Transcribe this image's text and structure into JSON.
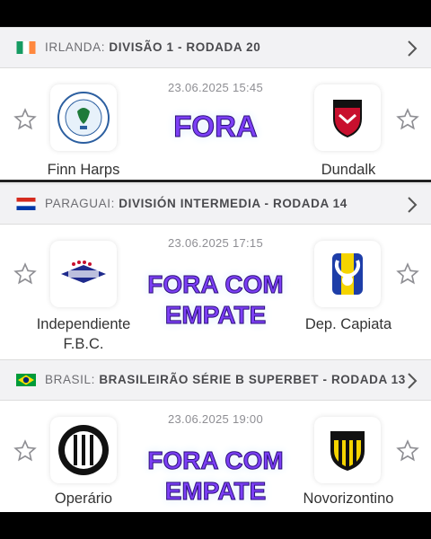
{
  "leagues": [
    {
      "country": "IRLANDA",
      "competition": "DIVISÃO 1 - RODADA 20",
      "flag": "ireland"
    },
    {
      "country": "PARAGUAI",
      "competition": "DIVISIÓN INTERMEDIA - RODADA 14",
      "flag": "paraguay"
    },
    {
      "country": "BRASIL",
      "competition": "BRASILEIRÃO SÉRIE B SUPERBET - RODADA 13",
      "flag": "brazil"
    }
  ],
  "matches": [
    {
      "datetime": "23.06.2025 15:45",
      "home": "Finn Harps",
      "away": "Dundalk",
      "verdict": "FORA"
    },
    {
      "datetime": "23.06.2025 17:15",
      "home": "Independiente\nF.B.C.",
      "away": "Dep. Capiata",
      "verdict": "FORA COM\nEMPATE"
    },
    {
      "datetime": "23.06.2025 19:00",
      "home": "Operário",
      "away": "Novorizontino",
      "verdict": "FORA COM\nEMPATE"
    }
  ],
  "colors": {
    "verdict": "#7c3ff5",
    "verdict_outline": "#2a0f7a",
    "league_bg": "#f2f2f4"
  },
  "icons": [
    "star-outline-icon",
    "chevron-right-icon",
    "flag-icon",
    "team-crest-icon"
  ]
}
